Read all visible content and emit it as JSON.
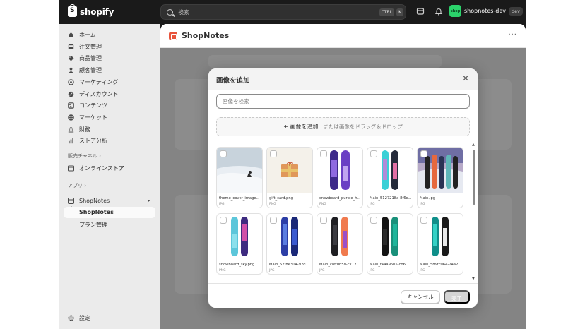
{
  "topbar": {
    "logo_text": "shopify",
    "search_placeholder": "検索",
    "shortcut_ctrl": "CTRL",
    "shortcut_k": "K",
    "store_initials": "shop",
    "store_name": "shopnotes-dev",
    "store_badge": "dev"
  },
  "sidebar": {
    "items": [
      {
        "label": "ホーム",
        "icon": "home-icon"
      },
      {
        "label": "注文管理",
        "icon": "inbox-icon"
      },
      {
        "label": "商品管理",
        "icon": "tag-icon"
      },
      {
        "label": "顧客管理",
        "icon": "person-icon"
      },
      {
        "label": "マーケティング",
        "icon": "target-icon"
      },
      {
        "label": "ディスカウント",
        "icon": "discount-icon"
      },
      {
        "label": "コンテンツ",
        "icon": "content-icon"
      },
      {
        "label": "マーケット",
        "icon": "globe-icon"
      },
      {
        "label": "財務",
        "icon": "bank-icon"
      },
      {
        "label": "ストア分析",
        "icon": "chart-icon"
      }
    ],
    "sales_channels_label": "販売チャネル ›",
    "online_store_label": "オンラインストア",
    "apps_label": "アプリ ›",
    "app_name": "ShopNotes",
    "sub_items": [
      "ShopNotes",
      "プラン管理"
    ],
    "settings_label": "設定"
  },
  "app": {
    "title": "ShopNotes",
    "more": "···"
  },
  "modal": {
    "title": "画像を追加",
    "search_placeholder": "画像を検索",
    "add_label": "+ 画像を追加",
    "drag_hint": "または画像をドラッグ＆ドロップ",
    "cancel_label": "キャンセル",
    "done_label": "完了",
    "images": [
      {
        "name": "theme_cover_image...",
        "type": "JPG"
      },
      {
        "name": "gift_card.png",
        "type": "PNG"
      },
      {
        "name": "snowboard_purple_h...",
        "type": "PNG"
      },
      {
        "name": "Main_5127218a-8f6c...",
        "type": "JPG"
      },
      {
        "name": "Main.jpg",
        "type": "JPG"
      },
      {
        "name": "snowboard_sky.png",
        "type": "PNG"
      },
      {
        "name": "Main_52f8e304-92d...",
        "type": "JPG"
      },
      {
        "name": "Main_c8ff0b5d-c712...",
        "type": "JPG"
      },
      {
        "name": "Main_f44a9605-cd6...",
        "type": "JPG"
      },
      {
        "name": "Main_589fc064-24a2...",
        "type": "JPG"
      }
    ]
  }
}
